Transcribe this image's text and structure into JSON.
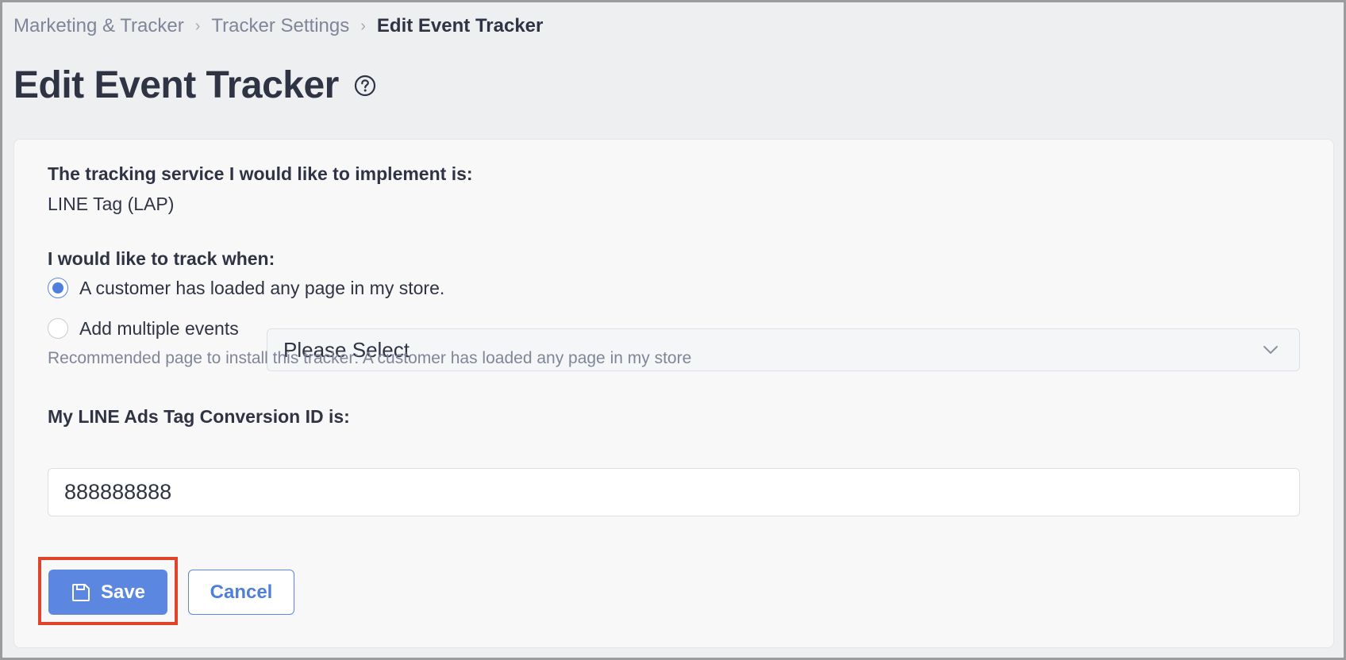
{
  "breadcrumb": {
    "items": [
      "Marketing & Tracker",
      "Tracker Settings"
    ],
    "current": "Edit Event Tracker"
  },
  "page": {
    "title": "Edit Event Tracker",
    "help_icon": "question-circle-icon"
  },
  "form": {
    "service_label": "The tracking service I would like to implement is:",
    "service_value": "LINE Tag (LAP)",
    "track_label": "I would like to track when:",
    "options": [
      {
        "label": "A customer has loaded any page in my store.",
        "checked": true
      },
      {
        "label": "Add multiple events",
        "checked": false
      }
    ],
    "events_select": {
      "value": "Please Select",
      "icon": "chevron-down-icon"
    },
    "recommendation": "Recommended page to install this tracker: A customer has loaded any page in my store",
    "conversion_label": "My LINE Ads Tag Conversion ID is:",
    "conversion_value": "888888888"
  },
  "actions": {
    "save_label": "Save",
    "save_icon": "floppy-disk-icon",
    "cancel_label": "Cancel"
  },
  "colors": {
    "accent": "#5b87e1",
    "highlight": "#e0442b",
    "text": "#2f3444",
    "muted": "#7f8698"
  }
}
